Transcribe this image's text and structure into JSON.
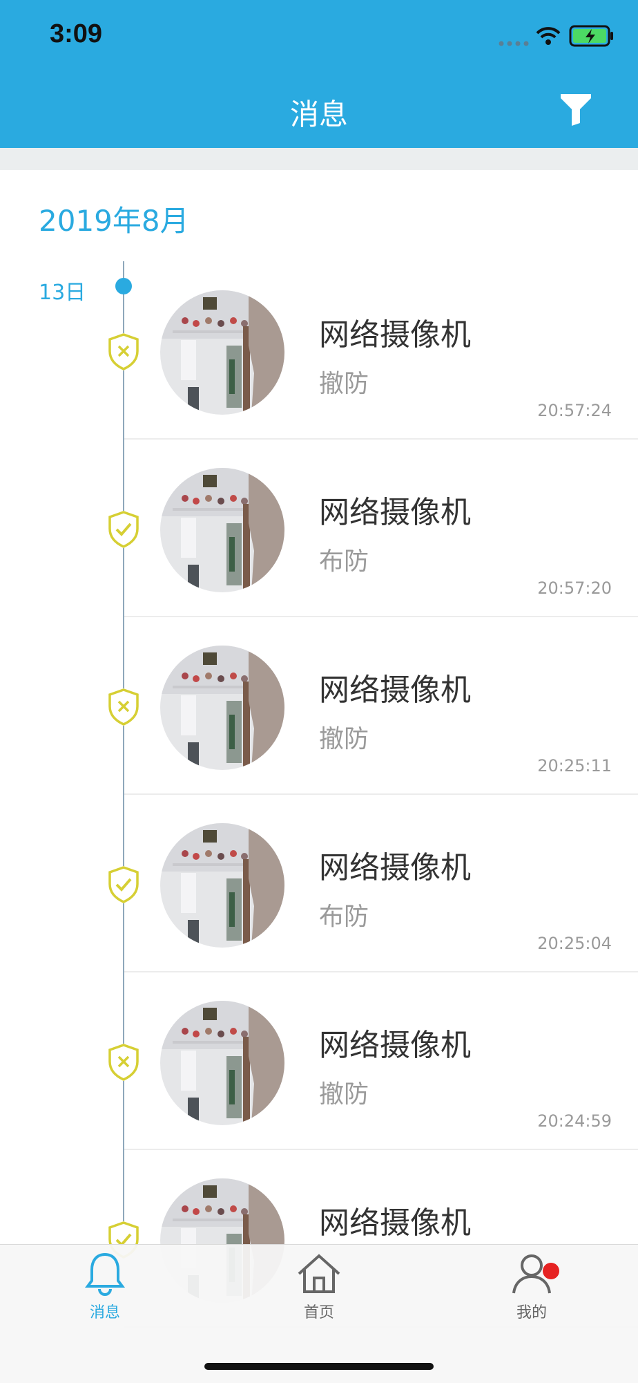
{
  "status_bar": {
    "time": "3:09"
  },
  "header": {
    "title": "消息"
  },
  "timeline": {
    "month": "2019年8月",
    "day": "13日"
  },
  "messages": [
    {
      "title": "网络摄像机",
      "status": "撤防",
      "time": "20:57:24",
      "shield_icon": "shield-x-icon"
    },
    {
      "title": "网络摄像机",
      "status": "布防",
      "time": "20:57:20",
      "shield_icon": "shield-check-icon"
    },
    {
      "title": "网络摄像机",
      "status": "撤防",
      "time": "20:25:11",
      "shield_icon": "shield-x-icon"
    },
    {
      "title": "网络摄像机",
      "status": "布防",
      "time": "20:25:04",
      "shield_icon": "shield-check-icon"
    },
    {
      "title": "网络摄像机",
      "status": "撤防",
      "time": "20:24:59",
      "shield_icon": "shield-x-icon"
    },
    {
      "title": "网络摄像机",
      "status": "",
      "time": "",
      "shield_icon": "shield-check-icon"
    }
  ],
  "tab_bar": {
    "tabs": [
      {
        "label": "消息",
        "icon": "bell-icon",
        "active": true
      },
      {
        "label": "首页",
        "icon": "home-icon",
        "active": false
      },
      {
        "label": "我的",
        "icon": "person-icon",
        "active": false
      }
    ]
  },
  "colors": {
    "primary": "#2aaae0",
    "shield": "#d6cf34",
    "badge": "#e62222",
    "text_dark": "#333333",
    "text_gray": "#9a9a9a"
  }
}
